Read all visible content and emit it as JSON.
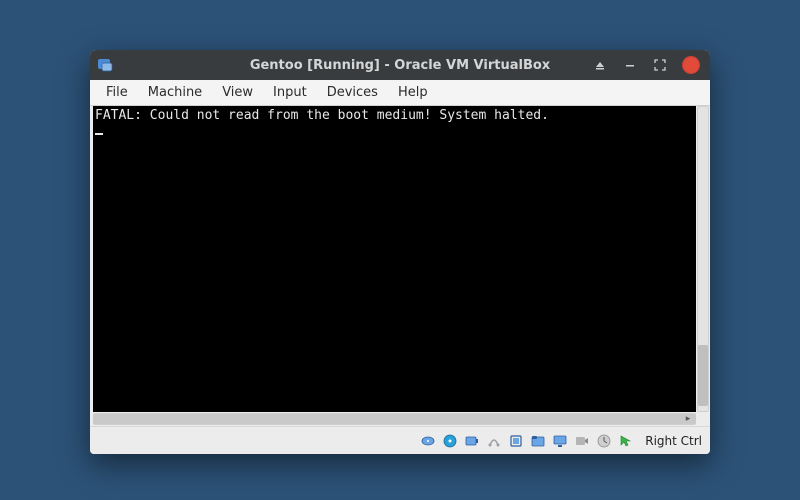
{
  "titlebar": {
    "title": "Gentoo [Running] - Oracle VM VirtualBox"
  },
  "menubar": {
    "items": [
      "File",
      "Machine",
      "View",
      "Input",
      "Devices",
      "Help"
    ]
  },
  "console": {
    "line1": "FATAL: Could not read from the boot medium! System halted."
  },
  "statusbar": {
    "host_key": "Right Ctrl",
    "icons": [
      "hard-disk-icon",
      "optical-disk-icon",
      "audio-icon",
      "network-icon",
      "usb-icon",
      "shared-folders-icon",
      "display-icon",
      "recording-icon",
      "cpu-icon",
      "mouse-integration-icon"
    ]
  }
}
